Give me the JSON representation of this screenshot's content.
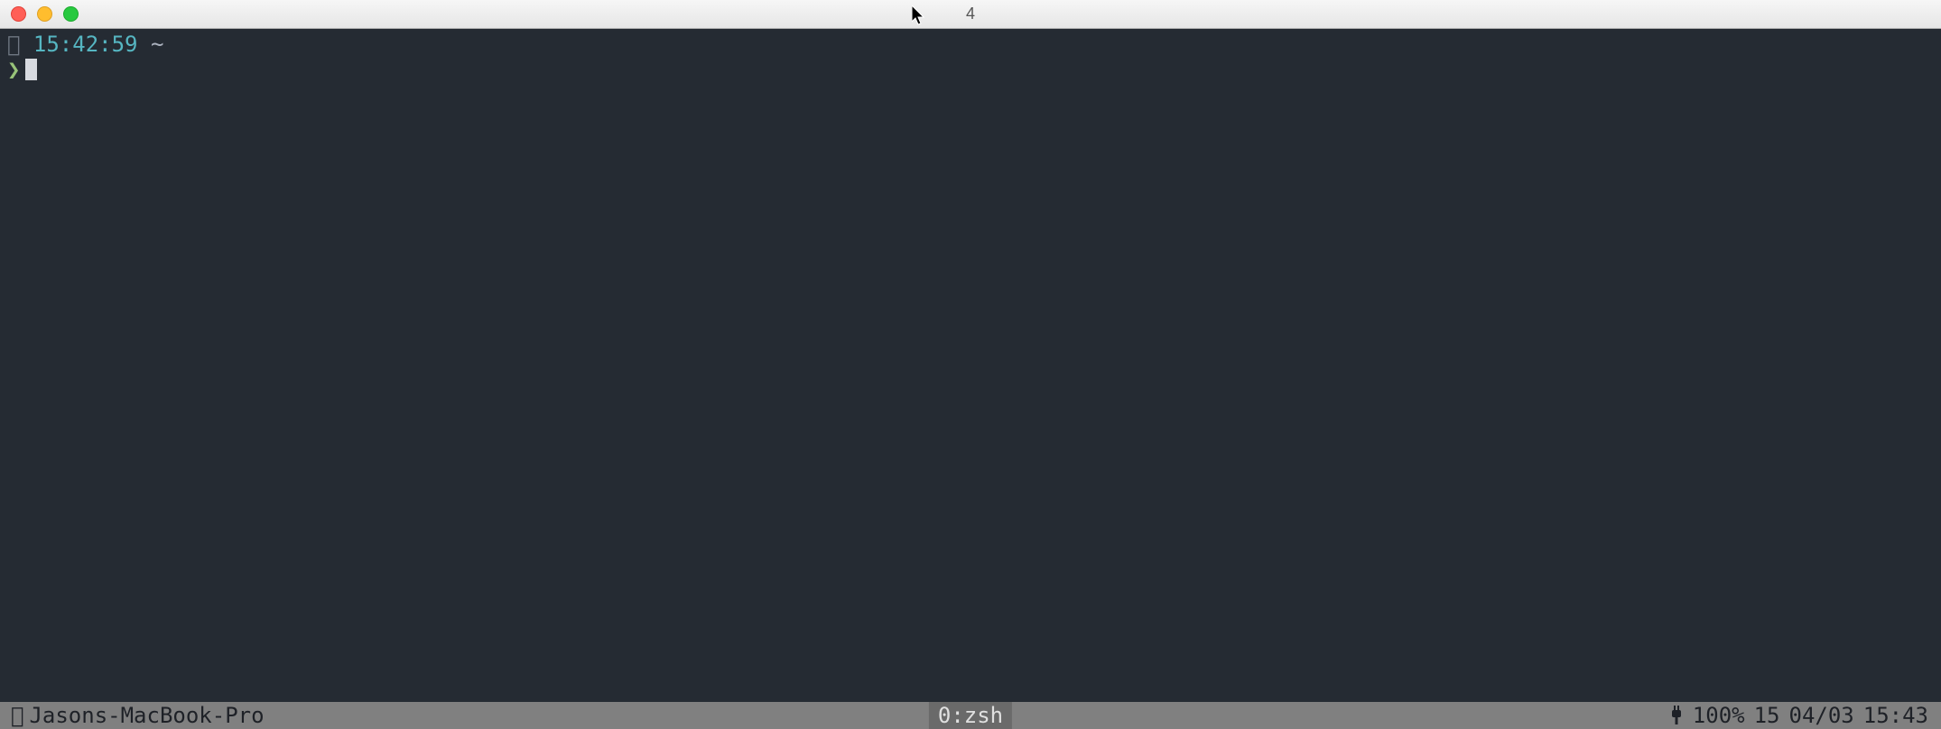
{
  "window": {
    "title": "4"
  },
  "prompt": {
    "time": "15:42:59",
    "path": "~",
    "char": "❯"
  },
  "statusbar": {
    "hostname": "Jasons-MacBook-Pro",
    "session": "0:zsh",
    "battery_percent": "100%",
    "day": "15",
    "date": "04/03",
    "clock": "15:43"
  }
}
